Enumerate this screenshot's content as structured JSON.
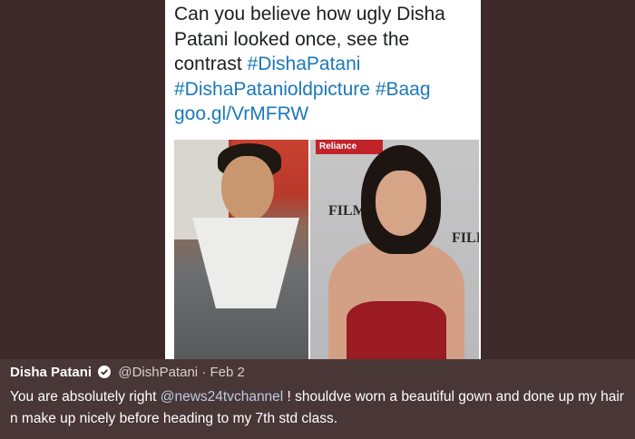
{
  "quoted_tweet": {
    "text_before": "Can you believe how ugly Disha Patani looked once, see the contrast ",
    "hashtag_1": "#DishaPatani",
    "hashtag_2": "#DishaPatanioldpicture",
    "hashtag_3": "#Baag",
    "link": "goo.gl/VrMFRW"
  },
  "images": {
    "right_banner": "Reliance",
    "right_logo_1": "FILMFA",
    "right_logo_2": "FILI"
  },
  "reply": {
    "author": "Disha Patani",
    "handle": "@DishPatani",
    "separator": "·",
    "date": "Feb 2",
    "text_before": "You are absolutely right ",
    "mention": "@news24tvchannel",
    "text_after": " ! shouldve worn a beautiful gown and done up my hair n make up nicely before heading to my 7th std class."
  },
  "colors": {
    "background": "#3e2a2b",
    "hashtag": "#1b78b8",
    "verified_badge": "#ffffff"
  }
}
